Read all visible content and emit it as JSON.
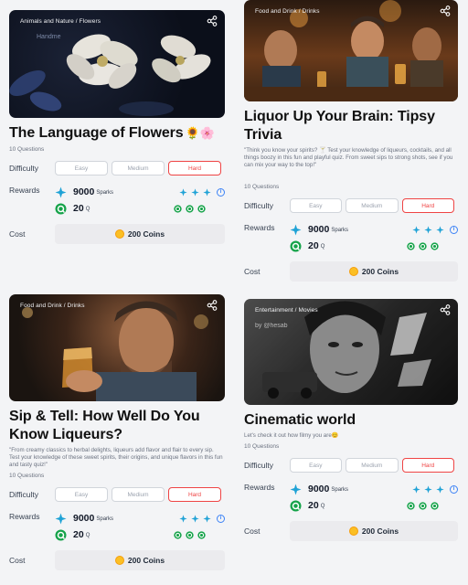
{
  "cards": [
    {
      "breadcrumb": "Animals and Nature / Flowers",
      "watermark": "Handme",
      "title": "The Language of Flowers",
      "title_emoji": "🌻🌸",
      "description": "",
      "questions": "10 Questions",
      "difficulty_label": "Difficulty",
      "difficulty": [
        "Easy",
        "Medium",
        "Hard"
      ],
      "selected": "Hard",
      "rewards_label": "Rewards",
      "sparks_value": "9000",
      "sparks_unit": "Sparks",
      "q_value": "20",
      "q_unit": "Q",
      "cost_label": "Cost",
      "cost_value": "200 Coins"
    },
    {
      "breadcrumb": "Food and Drink / Drinks",
      "title": "Liquor Up Your Brain: Tipsy Trivia",
      "description": "\"Think you know your spirits? 🍸 Test your knowledge of liqueurs, cocktails, and all things boozy in this fun and playful quiz. From sweet sips to strong shots, see if you can mix your way to the top!\"",
      "questions": "10 Questions",
      "difficulty_label": "Difficulty",
      "difficulty": [
        "Easy",
        "Medium",
        "Hard"
      ],
      "selected": "Hard",
      "rewards_label": "Rewards",
      "sparks_value": "9000",
      "sparks_unit": "Sparks",
      "q_value": "20",
      "q_unit": "Q",
      "cost_label": "Cost",
      "cost_value": "200 Coins"
    },
    {
      "breadcrumb": "Food and Drink / Drinks",
      "title": "Sip & Tell: How Well Do You Know Liqueurs?",
      "description": "\"From creamy classics to herbal delights, liqueurs add flavor and flair to every sip. Test your knowledge of these sweet spirits, their origins, and unique flavors in this fun and tasty quiz!\"",
      "questions": "10 Questions",
      "difficulty_label": "Difficulty",
      "difficulty": [
        "Easy",
        "Medium",
        "Hard"
      ],
      "selected": "Hard",
      "rewards_label": "Rewards",
      "sparks_value": "9000",
      "sparks_unit": "Sparks",
      "q_value": "20",
      "q_unit": "Q",
      "cost_label": "Cost",
      "cost_value": "200 Coins"
    },
    {
      "breadcrumb": "Entertainment / Movies",
      "watermark": "by @hesab",
      "title": "Cinematic world",
      "description": "Let's check it out how filmy you are😊",
      "questions": "10 Questions",
      "difficulty_label": "Difficulty",
      "difficulty": [
        "Easy",
        "Medium",
        "Hard"
      ],
      "selected": "Hard",
      "rewards_label": "Rewards",
      "sparks_value": "9000",
      "sparks_unit": "Sparks",
      "q_value": "20",
      "q_unit": "Q",
      "cost_label": "Cost",
      "cost_value": "200 Coins"
    }
  ],
  "colors": {
    "accent_hard": "#ef4444",
    "sparks": "#1fa2d6",
    "q": "#16a34a",
    "coin": "#fbbf24",
    "info": "#3b82f6"
  }
}
